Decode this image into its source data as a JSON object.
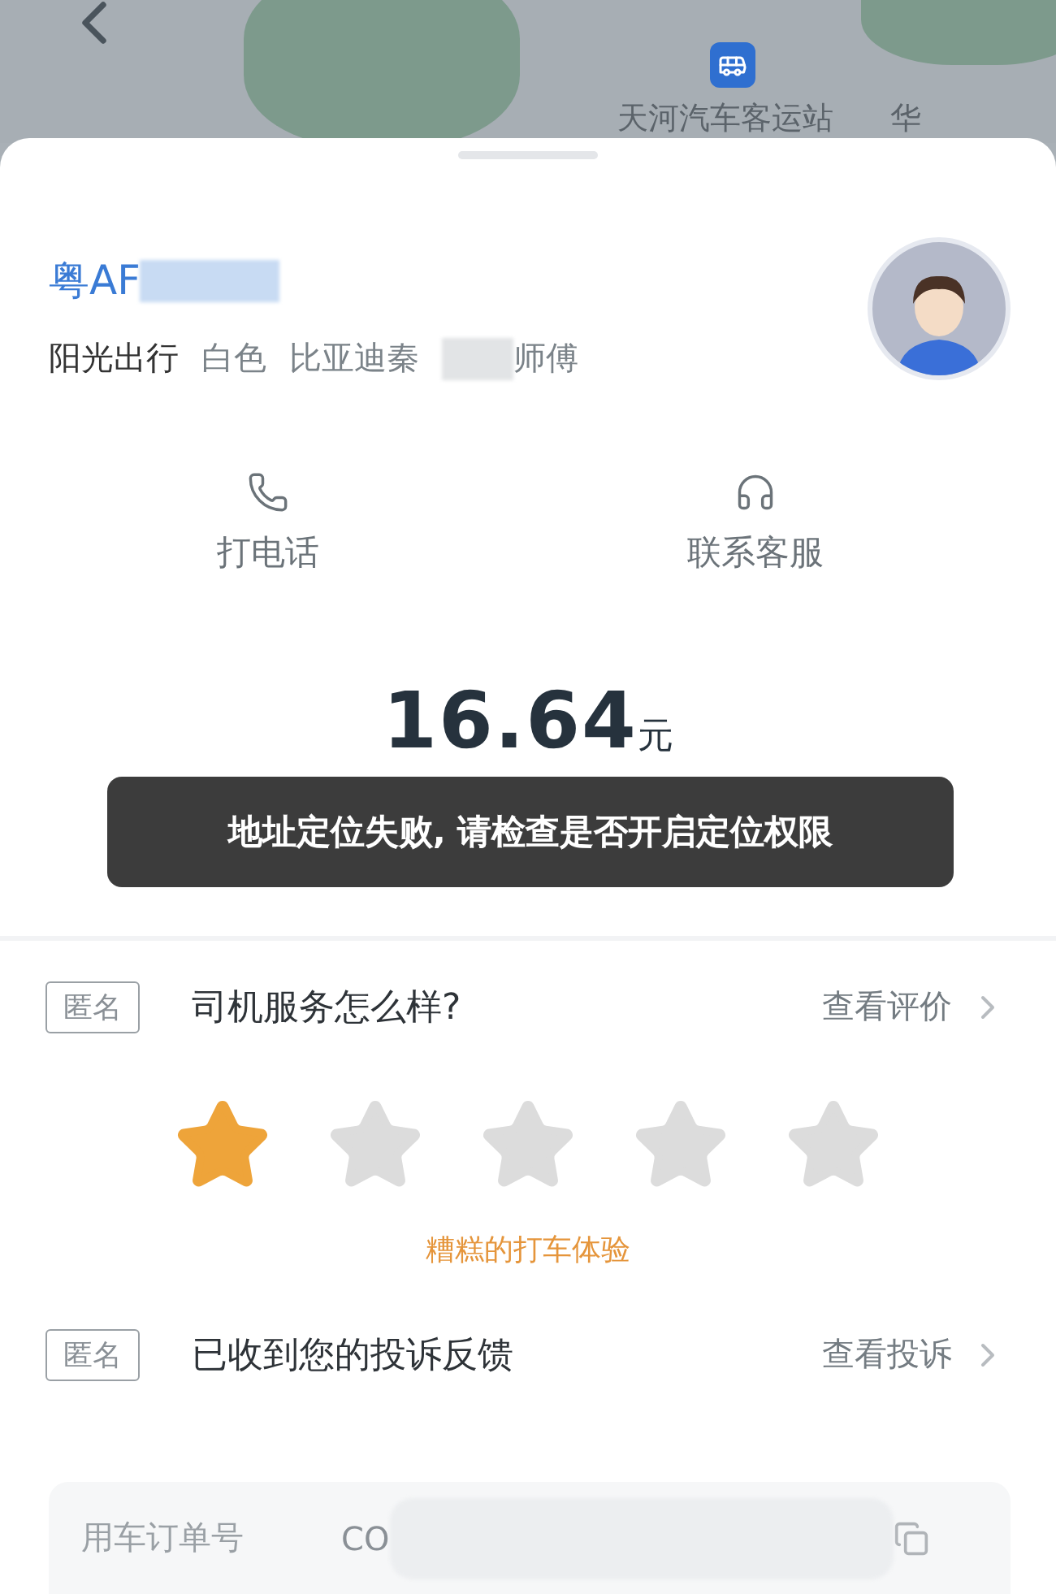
{
  "map": {
    "station_label": "天河汽车客运站",
    "edge_label": "华"
  },
  "driver": {
    "plate": "粤AF",
    "company": "阳光出行",
    "car_color": "白色",
    "car_model": "比亚迪秦",
    "title": "师傅"
  },
  "actions": [
    {
      "kind": "phone",
      "label": "打电话"
    },
    {
      "kind": "support",
      "label": "联系客服"
    }
  ],
  "fare": {
    "amount": "16.64",
    "unit": "元"
  },
  "toast": "地址定位失败, 请检查是否开启定位权限",
  "rating": {
    "tag": "匿名",
    "question": "司机服务怎么样?",
    "link": "查看评价",
    "stars": 1,
    "caption": "糟糕的打车体验"
  },
  "complaint": {
    "tag": "匿名",
    "text": "已收到您的投诉反馈",
    "link": "查看投诉"
  },
  "order": {
    "label": "用车订单号",
    "value": "CO"
  }
}
